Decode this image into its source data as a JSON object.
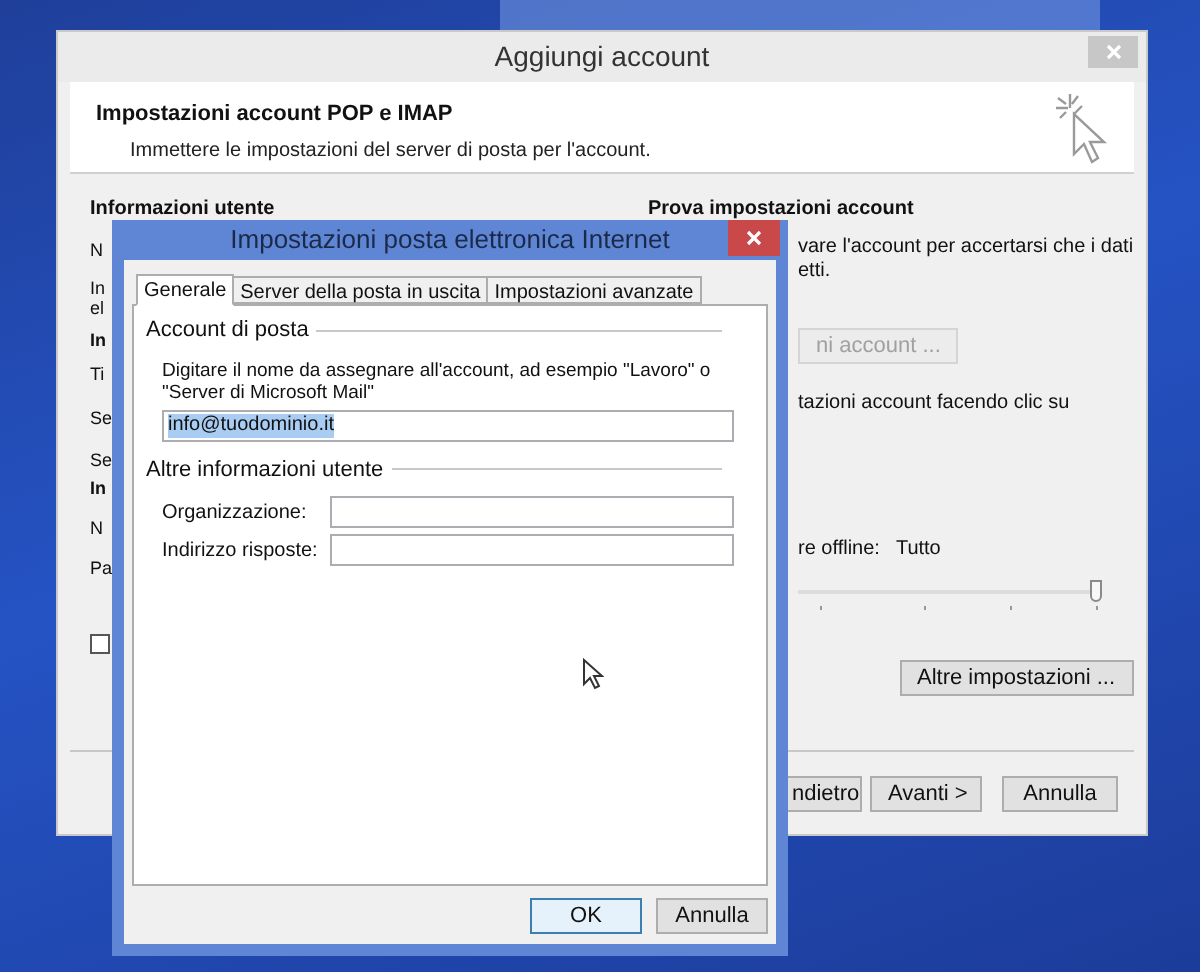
{
  "main_window": {
    "title": "Aggiungi account",
    "header": {
      "title": "Impostazioni account POP e IMAP",
      "subtitle": "Immettere le impostazioni del server di posta per l'account."
    },
    "left_section": {
      "heading": "Informazioni utente",
      "fragments": [
        {
          "text": "N",
          "bold": false
        },
        {
          "text": "In",
          "bold": false
        },
        {
          "text": "el",
          "bold": false
        },
        {
          "text": "In",
          "bold": true
        },
        {
          "text": "Ti",
          "bold": false
        },
        {
          "text": "Se",
          "bold": false
        },
        {
          "text": "Se",
          "bold": false
        },
        {
          "text": "In",
          "bold": true
        },
        {
          "text": "N",
          "bold": false
        },
        {
          "text": "Pa",
          "bold": false
        }
      ],
      "checkbox": {
        "checked": false
      }
    },
    "right_section": {
      "heading": "Prova impostazioni account",
      "description_lines": [
        "vare l'account per accertarsi che i dati",
        "etti."
      ],
      "test_button": {
        "label": "ni account ...",
        "disabled": true
      },
      "note": "tazioni account facendo clic su",
      "offline_label": "re offline:",
      "offline_value": "Tutto",
      "slider": {
        "level": 1
      },
      "more_button": "Altre impostazioni ..."
    },
    "footer_buttons": [
      "ndietro",
      "Avanti >",
      "Annulla"
    ]
  },
  "dialog": {
    "title": "Impostazioni posta elettronica Internet",
    "tabs": [
      {
        "label": "Generale",
        "selected": true
      },
      {
        "label": "Server della posta in uscita",
        "selected": false
      },
      {
        "label": "Impostazioni avanzate",
        "selected": false
      }
    ],
    "mail_account": {
      "group": "Account di posta",
      "instruction": "Digitare il nome da assegnare all'account, ad esempio \"Lavoro\" o \"Server di Microsoft Mail\"",
      "value": "info@tuodominio.it",
      "value_selected": true
    },
    "other_info": {
      "group": "Altre informazioni utente",
      "fields": [
        {
          "label": "Organizzazione:"
        },
        {
          "label": "Indirizzo risposte:"
        }
      ]
    },
    "buttons": [
      {
        "label": "OK",
        "default": true
      },
      {
        "label": "Annulla",
        "default": false
      }
    ]
  }
}
